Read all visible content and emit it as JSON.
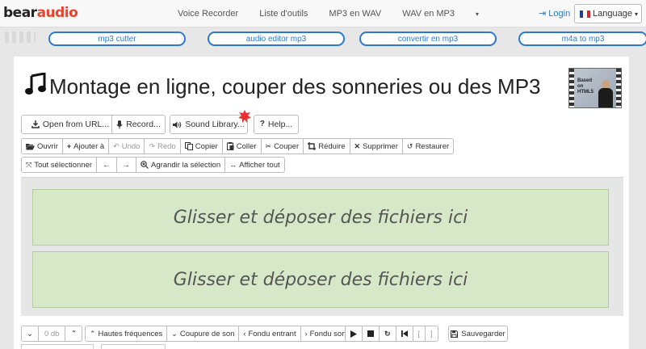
{
  "brand": {
    "part1": "bear",
    "part2": "audio"
  },
  "nav": {
    "items": [
      "Voice Recorder",
      "Liste d'outils",
      "MP3 en WAV",
      "WAV en MP3"
    ],
    "more": "▾",
    "login": "Login",
    "language": "Language"
  },
  "quick_links": [
    "mp3 cutter",
    "audio editor mp3",
    "convertir en mp3",
    "m4a to mp3"
  ],
  "page": {
    "title": "Montage en ligne, couper des sonneries ou des MP3",
    "thumb_text": "Based on HTML5"
  },
  "toolbar_main": {
    "open_url": "Open from URL...",
    "record": "Record...",
    "sound_library": "Sound Library...",
    "help": "Help..."
  },
  "edit_row": {
    "ouvrir": "Ouvrir",
    "ajouter": "Ajouter à",
    "undo": "Undo",
    "redo": "Redo",
    "copier": "Copier",
    "coller": "Coller",
    "couper": "Couper",
    "reduire": "Réduire",
    "supprimer": "Supprimer",
    "restaurer": "Restaurer"
  },
  "select_row": {
    "select_all": "Tout sélectionner",
    "left": "←",
    "right": "→",
    "zoom_selection": "Agrandir la sélection",
    "show_all": "Afficher tout"
  },
  "drop_zones": [
    "Glisser et déposer des fichiers ici",
    "Glisser et déposer des fichiers ici"
  ],
  "bottom": {
    "volume_down": "⌄",
    "volume": "0 db",
    "volume_up": "⌃",
    "high_freq": "Hautes fréquences",
    "low_cut": "Coupure de son",
    "fade_in": "Fondu entrant",
    "fade_out": "Fondu sortant",
    "save": "Sauvegarder"
  },
  "colors": {
    "accent": "#2b78d1",
    "brand_red": "#e8432c",
    "drop_bg": "#d6e8c8",
    "link": "#337ab7"
  }
}
